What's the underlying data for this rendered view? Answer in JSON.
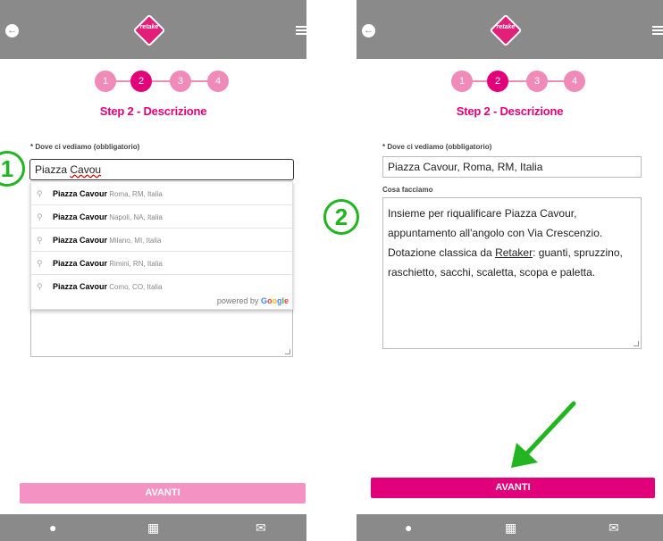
{
  "app": {
    "logo_text": "retake"
  },
  "steps": [
    "1",
    "2",
    "3",
    "4"
  ],
  "step_title": "Step 2 - Descrizione",
  "left": {
    "where_label": "* Dove ci vediamo (obbligatorio)",
    "where_value_a": "Piazza ",
    "where_value_b": "Cavou",
    "suggestions": [
      {
        "main": "Piazza Cavour",
        "secondary": "Roma, RM, Italia"
      },
      {
        "main": "Piazza Cavour",
        "secondary": "Napoli, NA, Italia"
      },
      {
        "main": "Piazza Cavour",
        "secondary": "Milano, MI, Italia"
      },
      {
        "main": "Piazza Cavour",
        "secondary": "Rimini, RN, Italia"
      },
      {
        "main": "Piazza Cavour",
        "secondary": "Como, CO, Italia"
      }
    ],
    "powered_by": "powered by",
    "google": [
      "G",
      "o",
      "o",
      "g",
      "l",
      "e"
    ],
    "button_label": "AVANTI",
    "annotation": "1"
  },
  "right": {
    "where_label": "* Dove ci vediamo (obbligatorio)",
    "where_value": "Piazza Cavour, Roma, RM, Italia",
    "what_label": "Cosa facciamo",
    "what_value_a": "Insieme per riqualificare Piazza Cavour, appuntamento all'angolo con Via Crescenzio. Dotazione classica da ",
    "what_value_b": "Retaker",
    "what_value_c": ": guanti, spruzzino, raschietto, sacchi, scaletta, scopa e paletta.",
    "button_label": "AVANTI",
    "annotation": "2"
  },
  "colors": {
    "brand": "#e2007a",
    "brand_light": "#f08ab8",
    "bar": "#8a8a8a",
    "annotation": "#22b521"
  },
  "icons": [
    "back-arrow-icon",
    "hamburger-menu-icon",
    "user-icon",
    "calendar-icon",
    "envelope-icon",
    "map-pin-icon"
  ]
}
